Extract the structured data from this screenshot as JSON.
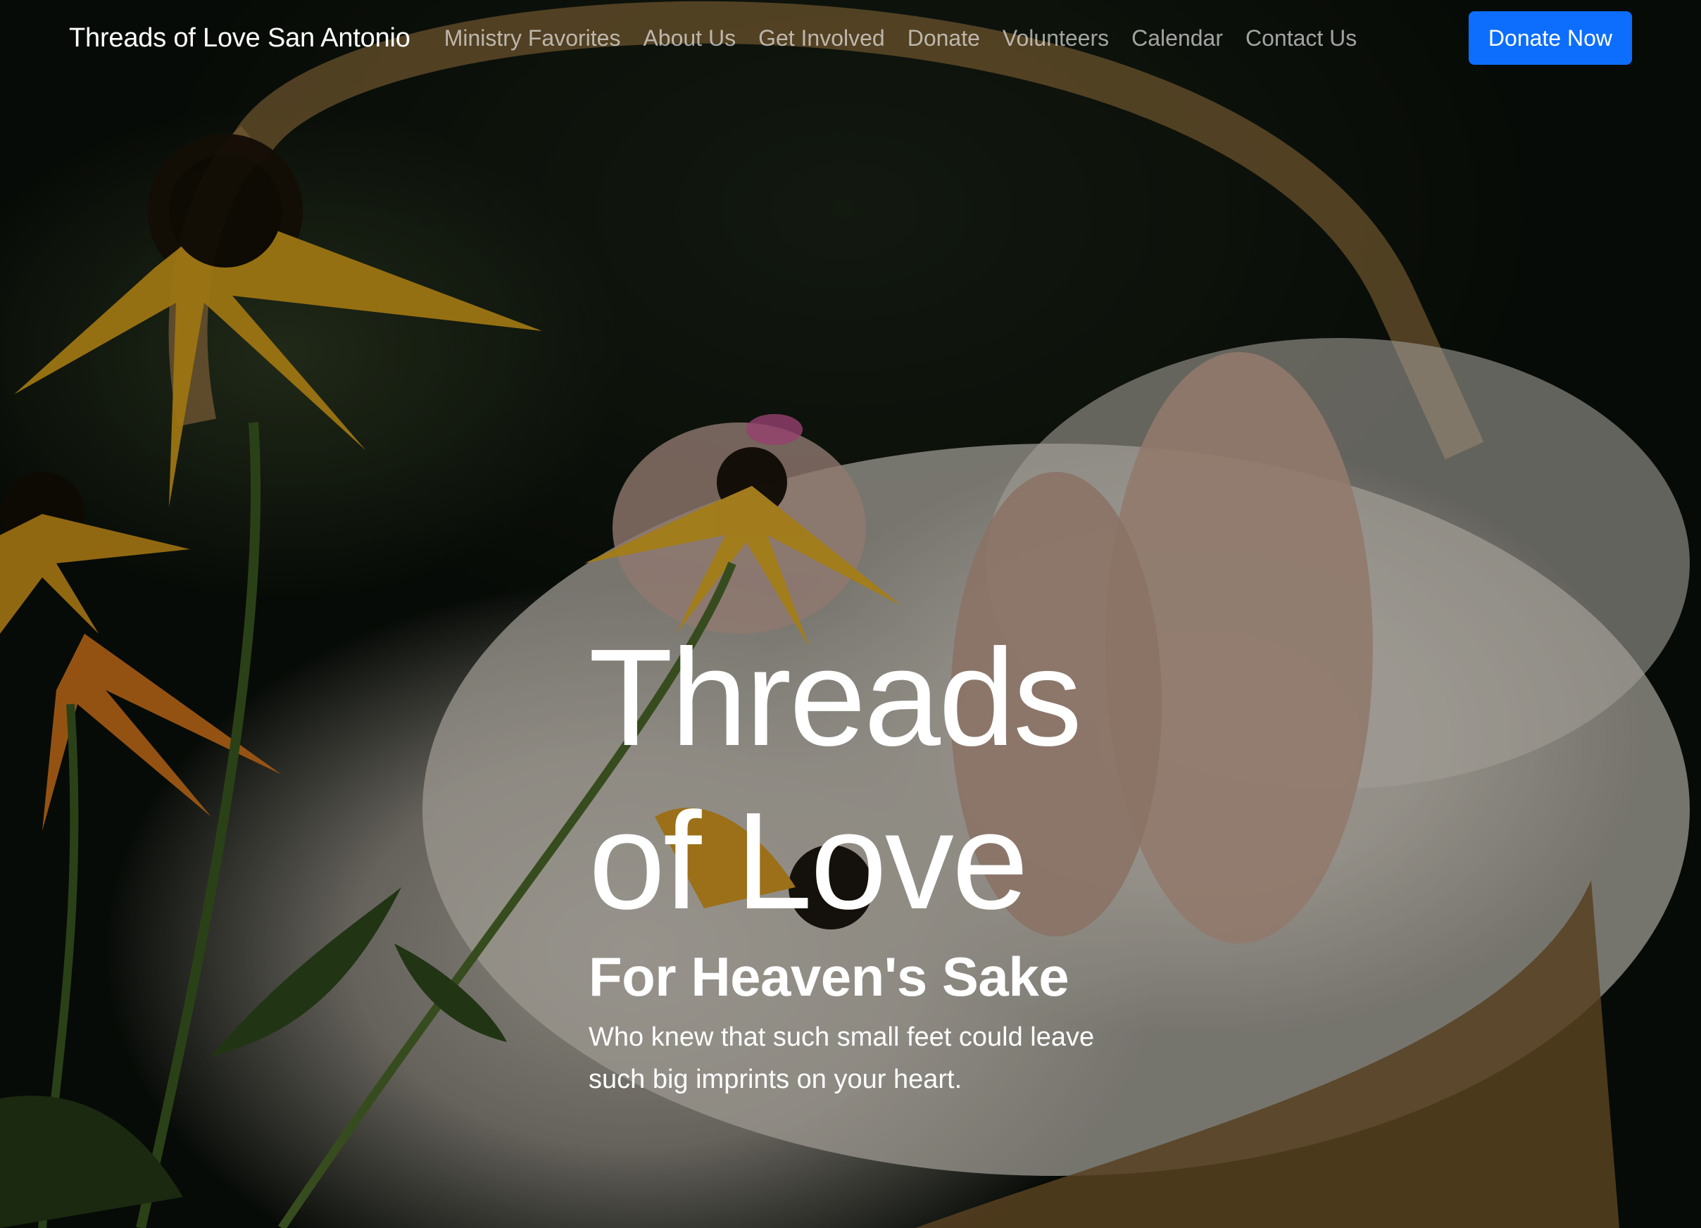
{
  "navbar": {
    "brand": "Threads of Love San Antonio",
    "links": [
      {
        "label": "Ministry Favorites"
      },
      {
        "label": "About Us"
      },
      {
        "label": "Get Involved"
      },
      {
        "label": "Donate"
      },
      {
        "label": "Volunteers"
      },
      {
        "label": "Calendar"
      },
      {
        "label": "Contact Us"
      }
    ],
    "cta_label": "Donate Now"
  },
  "hero": {
    "title_line1": "Threads",
    "title_line2": "of Love",
    "subtitle": "For Heaven's Sake",
    "lead": "Who knew that such small feet could leave such big imprints on your heart."
  },
  "colors": {
    "accent": "#0d6efd",
    "nav_text": "#ffffff"
  }
}
